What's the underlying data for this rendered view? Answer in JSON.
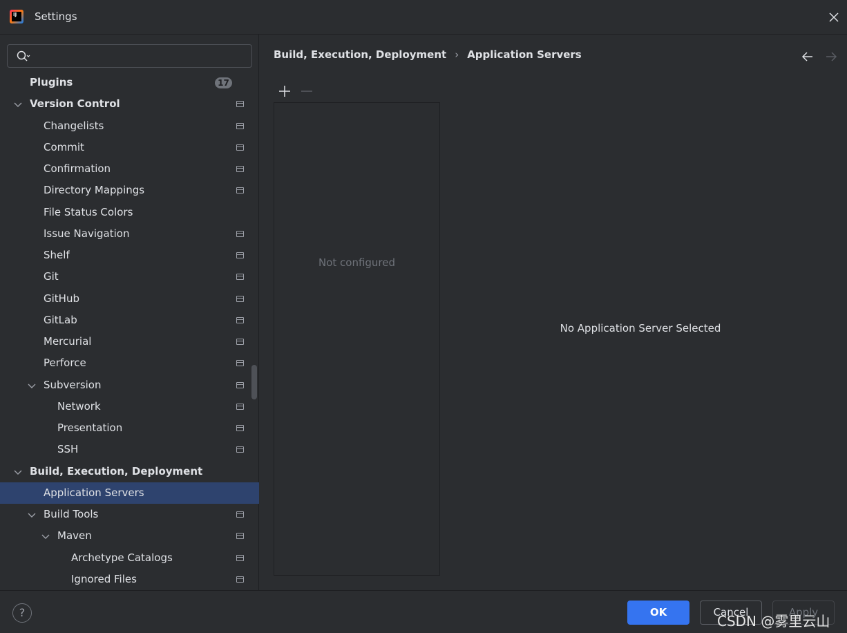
{
  "window": {
    "title": "Settings",
    "app_logo_text": "IJ"
  },
  "search": {
    "value": "",
    "placeholder": ""
  },
  "tree": [
    {
      "label": "Plugins",
      "depth": 0,
      "bold": true,
      "badge": "17"
    },
    {
      "label": "Version Control",
      "depth": 0,
      "bold": true,
      "expanded": true,
      "page_icon": true
    },
    {
      "label": "Changelists",
      "depth": 1,
      "page_icon": true
    },
    {
      "label": "Commit",
      "depth": 1,
      "page_icon": true
    },
    {
      "label": "Confirmation",
      "depth": 1,
      "page_icon": true
    },
    {
      "label": "Directory Mappings",
      "depth": 1,
      "page_icon": true
    },
    {
      "label": "File Status Colors",
      "depth": 1
    },
    {
      "label": "Issue Navigation",
      "depth": 1,
      "page_icon": true
    },
    {
      "label": "Shelf",
      "depth": 1,
      "page_icon": true
    },
    {
      "label": "Git",
      "depth": 1,
      "page_icon": true
    },
    {
      "label": "GitHub",
      "depth": 1,
      "page_icon": true
    },
    {
      "label": "GitLab",
      "depth": 1,
      "page_icon": true
    },
    {
      "label": "Mercurial",
      "depth": 1,
      "page_icon": true
    },
    {
      "label": "Perforce",
      "depth": 1,
      "page_icon": true
    },
    {
      "label": "Subversion",
      "depth": 1,
      "expanded": true,
      "page_icon": true
    },
    {
      "label": "Network",
      "depth": 2,
      "page_icon": true
    },
    {
      "label": "Presentation",
      "depth": 2,
      "page_icon": true
    },
    {
      "label": "SSH",
      "depth": 2,
      "page_icon": true
    },
    {
      "label": "Build, Execution, Deployment",
      "depth": 0,
      "bold": true,
      "expanded": true
    },
    {
      "label": "Application Servers",
      "depth": 1,
      "selected": true
    },
    {
      "label": "Build Tools",
      "depth": 1,
      "expanded": true,
      "page_icon": true
    },
    {
      "label": "Maven",
      "depth": 2,
      "expanded": true,
      "page_icon": true
    },
    {
      "label": "Archetype Catalogs",
      "depth": 3,
      "page_icon": true
    },
    {
      "label": "Ignored Files",
      "depth": 3,
      "page_icon": true
    }
  ],
  "breadcrumb": {
    "parent": "Build, Execution, Deployment",
    "separator": "›",
    "current": "Application Servers"
  },
  "toolbar": {
    "add_icon": "plus-icon",
    "remove_icon": "minus-icon"
  },
  "server_list": {
    "empty_text": "Not configured"
  },
  "detail": {
    "empty_text": "No Application Server Selected"
  },
  "footer": {
    "help_label": "?",
    "ok_label": "OK",
    "cancel_label": "Cancel",
    "apply_label": "Apply"
  },
  "watermark": "CSDN @雾里云山",
  "colors": {
    "background": "#2b2d30",
    "selection": "#2e436e",
    "accent": "#3574f0",
    "text": "#dfe1e5",
    "muted_text": "#6f737a"
  }
}
